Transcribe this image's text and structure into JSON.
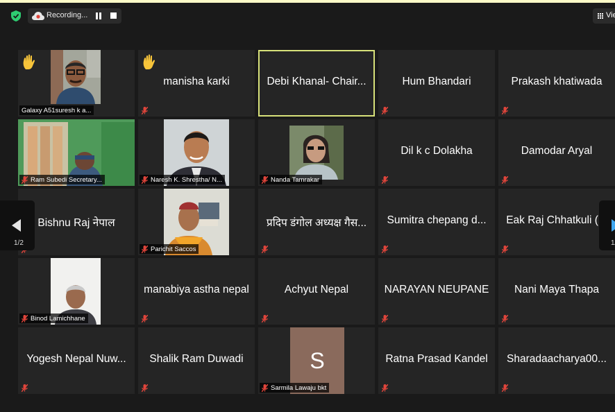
{
  "recording": {
    "label": "Recording..."
  },
  "view_button": {
    "label": "Vie"
  },
  "pager": {
    "left_page": "1/2",
    "right_page": "1/"
  },
  "participants": [
    {
      "label": "Galaxy A51suresh k a...",
      "hand": true
    },
    {
      "name": "manisha karki",
      "hand": true
    },
    {
      "name": "Debi Khanal- Chair..."
    },
    {
      "name": "Hum Bhandari"
    },
    {
      "name": "Prakash khatiwada"
    },
    {
      "label": "Ram Subedi Secretary..."
    },
    {
      "label": "Naresh K. Shrestha/ N..."
    },
    {
      "label": "Nanda Tamrakar"
    },
    {
      "name": "Dil k c Dolakha"
    },
    {
      "name": "Damodar Aryal"
    },
    {
      "name": "Bishnu Raj नेपाल"
    },
    {
      "label": "Parichit Saccos"
    },
    {
      "name": "प्रदिप डंगोल अध्यक्ष गैस..."
    },
    {
      "name": "Sumitra chepang d..."
    },
    {
      "name": "Eak Raj Chhatkuli (..."
    },
    {
      "label": "Binod Lamichhane"
    },
    {
      "name": "manabiya astha nepal"
    },
    {
      "name": "Achyut Nepal"
    },
    {
      "name": "NARAYAN NEUPANE"
    },
    {
      "name": "Nani Maya Thapa"
    },
    {
      "name": "Yogesh Nepal Nuw..."
    },
    {
      "name": "Shalik Ram Duwadi"
    },
    {
      "label": "Sarmila Lawaju bkt",
      "initial": "S"
    },
    {
      "name": "Ratna Prasad Kandel"
    },
    {
      "name": "Sharadaacharya00..."
    }
  ],
  "colors": {
    "active_speaker_border": "#d8e27a",
    "muted_mic": "#e0453b",
    "raise_hand": "#f7c43a",
    "avatar_bg": "#8a6a5c",
    "shield": "#2ecc71",
    "nav_arrow_right": "#41a9f2"
  }
}
